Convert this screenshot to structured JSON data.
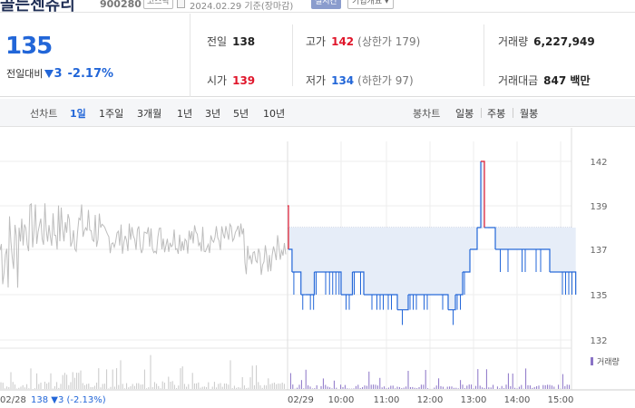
{
  "header": {
    "name": "골든센츄리",
    "code": "900280",
    "market": "코스닥",
    "as_of": "2024.02.29 기준(장마감)",
    "realtime_badge": "실시간",
    "info_button": "기업개요 ▾"
  },
  "quote": {
    "price": "135",
    "change_label": "전일대비",
    "change": "3",
    "change_pct": "-2.17%",
    "prev_close_label": "전일",
    "prev_close": "138",
    "open_label": "시가",
    "open": "139",
    "high_label": "고가",
    "high": "142",
    "upper_limit": "(상한가 179)",
    "low_label": "저가",
    "low": "134",
    "lower_limit": "(하한가 97)",
    "volume_label": "거래량",
    "volume": "6,227,949",
    "value_label": "거래대금",
    "value": "847 백만"
  },
  "tabs": {
    "line_chart_label": "선차트",
    "periods": [
      "1일",
      "1주일",
      "3개월",
      "1년",
      "3년",
      "5년",
      "10년"
    ],
    "active_period": "1일",
    "candle_label": "봉차트",
    "candles": [
      "일봉",
      "주봉",
      "월봉"
    ]
  },
  "chart_data": {
    "type": "line",
    "title": "",
    "y_ticks": [
      "142",
      "139",
      "137",
      "135",
      "132"
    ],
    "y_range": [
      132,
      142
    ],
    "reference_line": 138,
    "colors": {
      "up": "#e0162b",
      "down": "#2266d8",
      "fill": "#e6edf8",
      "history": "#bdbdbd"
    },
    "x_ticks": [
      "02/29",
      "10:00",
      "11:00",
      "12:00",
      "13:00",
      "14:00",
      "15:00"
    ],
    "previous_day_label": "02/28",
    "previous_day_summary": "138 ▼3 (-2.13%)",
    "volume_label": "거래량",
    "intraday_price": [
      [
        "09:00",
        139
      ],
      [
        "09:01",
        137
      ],
      [
        "09:05",
        136
      ],
      [
        "09:15",
        135
      ],
      [
        "09:20",
        135
      ],
      [
        "09:30",
        136
      ],
      [
        "09:45",
        136
      ],
      [
        "10:00",
        135
      ],
      [
        "10:15",
        136
      ],
      [
        "10:30",
        135
      ],
      [
        "10:45",
        135
      ],
      [
        "11:00",
        135
      ],
      [
        "11:15",
        134
      ],
      [
        "11:30",
        135
      ],
      [
        "11:45",
        135
      ],
      [
        "12:00",
        135
      ],
      [
        "12:15",
        135
      ],
      [
        "12:25",
        134
      ],
      [
        "12:35",
        135
      ],
      [
        "12:45",
        136
      ],
      [
        "12:55",
        137
      ],
      [
        "13:05",
        138
      ],
      [
        "13:10",
        142
      ],
      [
        "13:15",
        138
      ],
      [
        "13:20",
        138
      ],
      [
        "13:30",
        137
      ],
      [
        "13:45",
        137
      ],
      [
        "14:00",
        137
      ],
      [
        "14:15",
        137
      ],
      [
        "14:30",
        137
      ],
      [
        "14:45",
        136
      ],
      [
        "15:00",
        136
      ],
      [
        "15:20",
        135
      ]
    ]
  }
}
